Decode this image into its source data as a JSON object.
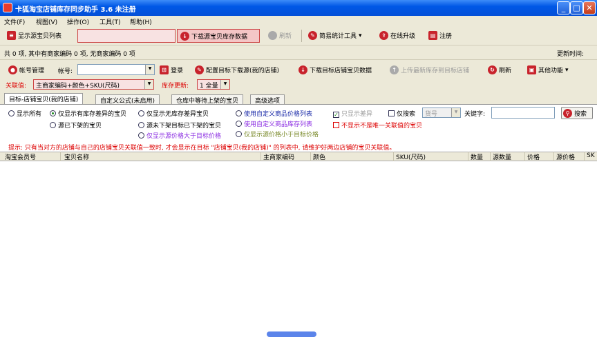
{
  "window": {
    "title": "卡狐淘宝店铺库存同步助手  3.6 未注册"
  },
  "menu": [
    "文件(F)",
    "视图(V)",
    "操作(O)",
    "工具(T)",
    "帮助(H)"
  ],
  "toolbar": {
    "show_source_list": "显示源宝贝列表",
    "download_source": "下载源宝贝库存数据",
    "refresh": "刷新",
    "stats_tools": "简易统计工具",
    "online_upgrade": "在线升级",
    "register": "注册"
  },
  "status": {
    "summary": "共 0 项, 其中有商家编码 0 项, 无商家编码 0 项",
    "update_time_label": "更新时间:"
  },
  "account_bar": {
    "account_manage": "帐号管理",
    "account_label": "帐号:",
    "account_value": "",
    "login": "登录",
    "config_target": "配置目标下载源(我的店铺)",
    "download_target": "下载目标店铺宝贝数据",
    "upload_stock": "上传最新库存到目标店铺",
    "refresh": "刷新",
    "other": "其他功能"
  },
  "link_bar": {
    "link_label": "关联值:",
    "link_value": "主商家编码+颜色+SKU(尺码)",
    "stock_update_label": "库存更新:",
    "stock_update_value": "1 全量"
  },
  "tabs": [
    "目标-店铺宝贝(我的店铺)",
    "自定义公式(未启用)",
    "仓库中等待上架的宝贝",
    "高级选项"
  ],
  "filters": {
    "show_all": "显示所有",
    "only_diff": "仅显示有库存差异的宝贝",
    "only_no_stock_diff": "仅显示无库存差异宝贝",
    "use_custom_price": "使用自定义商品价格列表",
    "only_diff_chk": "只显示差异",
    "only_search": "仅搜索",
    "search_field_value": "货号",
    "keyword_label": "关键字:",
    "keyword_value": "",
    "search": "搜索",
    "source_off": "源已下架的宝贝",
    "source_not_off_target_off": "源未下架目标已下架的宝贝",
    "use_custom_stock": "使用自定义商品库存列表",
    "hide_no_unique": "不显示不是唯一关联值的宝贝",
    "source_price_gt": "仅显示源价格大于目标价格",
    "source_price_lt": "仅显示源价格小于目标价格"
  },
  "hint": "提示: 只有当对方的店铺与自己的店铺宝贝关联值一致时, 才会显示在目标 \"店铺宝贝(我的店铺)\" 的列表中, 请维护好两边店铺的宝贝关联值。",
  "table": {
    "columns": [
      "淘宝会员号",
      "宝贝名称",
      "主商家编码",
      "颜色",
      "SKU(尺码)",
      "数量",
      "源数量",
      "价格",
      "源价格",
      "SK"
    ]
  }
}
